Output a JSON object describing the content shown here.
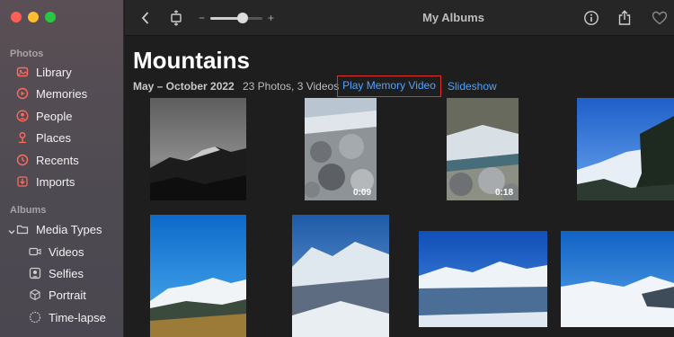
{
  "window": {
    "title": "My Albums"
  },
  "sidebar": {
    "photos_header": "Photos",
    "albums_header": "Albums",
    "photos_items": [
      {
        "label": "Library",
        "icon": "photo-library-icon"
      },
      {
        "label": "Memories",
        "icon": "memories-icon"
      },
      {
        "label": "People",
        "icon": "person-icon"
      },
      {
        "label": "Places",
        "icon": "map-pin-icon"
      },
      {
        "label": "Recents",
        "icon": "clock-icon"
      },
      {
        "label": "Imports",
        "icon": "import-icon"
      }
    ],
    "media_types": {
      "label": "Media Types",
      "expanded": true
    },
    "media_items": [
      {
        "label": "Videos",
        "icon": "video-icon"
      },
      {
        "label": "Selfies",
        "icon": "selfie-icon"
      },
      {
        "label": "Portrait",
        "icon": "portrait-cube-icon"
      },
      {
        "label": "Time-lapse",
        "icon": "timelapse-icon"
      }
    ],
    "accent_color": "#ff6b5f"
  },
  "toolbar": {
    "zoom_minus": "−",
    "zoom_plus": "+",
    "zoom_level": 0.62
  },
  "album": {
    "title": "Mountains",
    "date_range": "May – October 2022",
    "counts": "23 Photos, 3 Videos",
    "play_memory_label": "Play Memory Video",
    "slideshow_label": "Slideshow",
    "link_color": "#4ea2ff",
    "highlight_color": "#e2332b"
  },
  "grid": {
    "videos": [
      {
        "duration": "0:09"
      },
      {
        "duration": "0:18"
      }
    ]
  }
}
